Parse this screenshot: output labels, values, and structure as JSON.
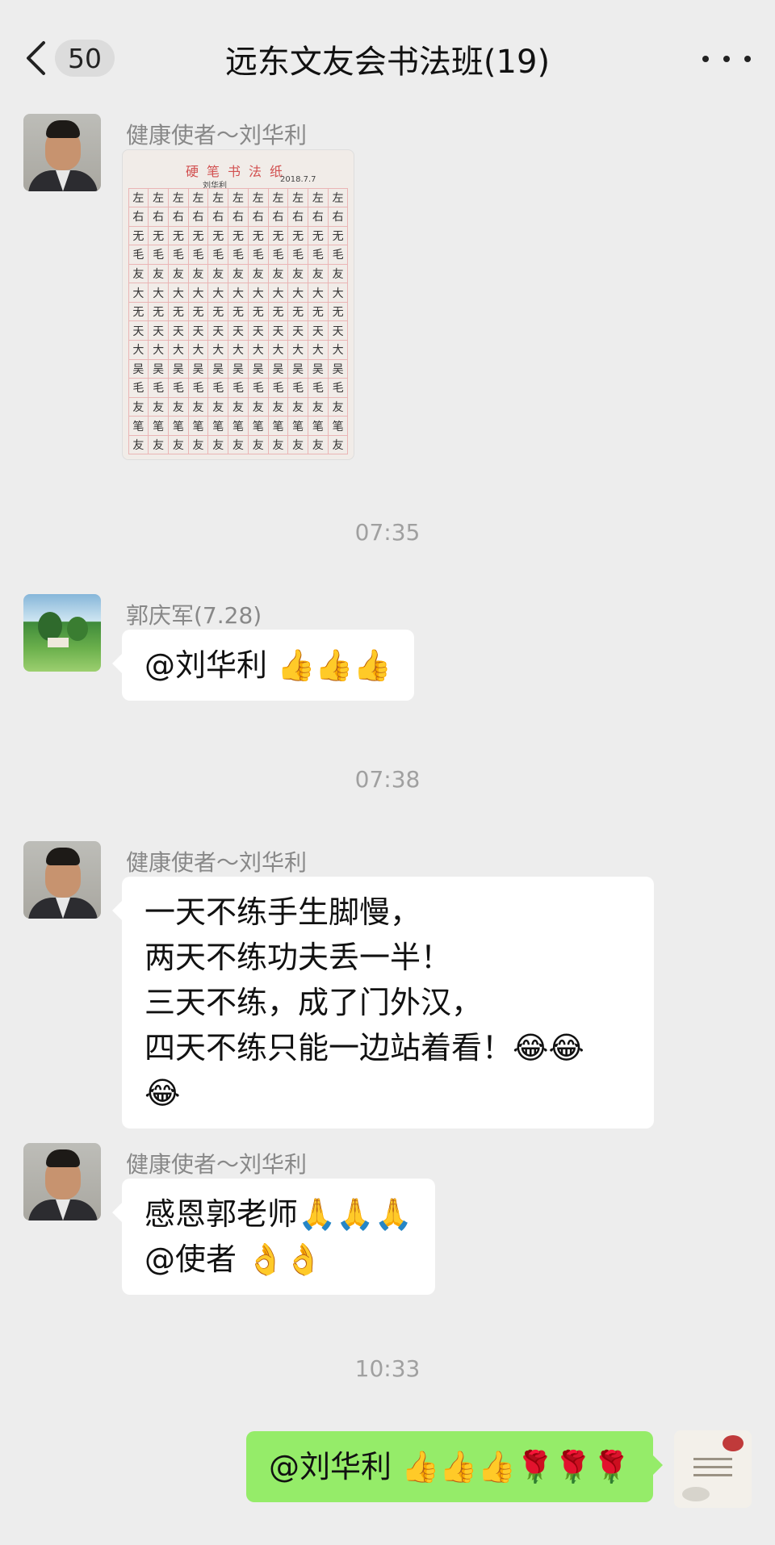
{
  "header": {
    "unread_count": "50",
    "title": "远东文友会书法班(19)"
  },
  "messages": [
    {
      "sender": "健康使者～刘华利",
      "type": "image",
      "image": {
        "sheet_title": "硬笔书法纸",
        "sheet_name": "刘华利",
        "sheet_date": "2018.7.7",
        "rows": [
          "左",
          "右",
          "无",
          "毛",
          "友",
          "大",
          "无",
          "天",
          "大",
          "吴",
          "毛",
          "友",
          "笔",
          "友"
        ]
      }
    },
    {
      "type": "time",
      "text": "07:35"
    },
    {
      "sender": "郭庆军(7.28)",
      "type": "text",
      "lines": [
        "@刘华利 👍👍👍"
      ]
    },
    {
      "type": "time",
      "text": "07:38"
    },
    {
      "sender": "健康使者～刘华利",
      "type": "text",
      "lines": [
        "一天不练手生脚慢，",
        "两天不练功夫丢一半！",
        "三天不练，成了门外汉，",
        "四天不练只能一边站着看！😂😂",
        "😂"
      ]
    },
    {
      "sender": "健康使者～刘华利",
      "type": "text",
      "lines": [
        "感恩郭老师🙏🙏🙏",
        "@使者 👌👌"
      ]
    },
    {
      "type": "time",
      "text": "10:33"
    },
    {
      "type": "self-text",
      "lines": [
        "@刘华利 👍👍👍🌹🌹🌹"
      ]
    }
  ]
}
